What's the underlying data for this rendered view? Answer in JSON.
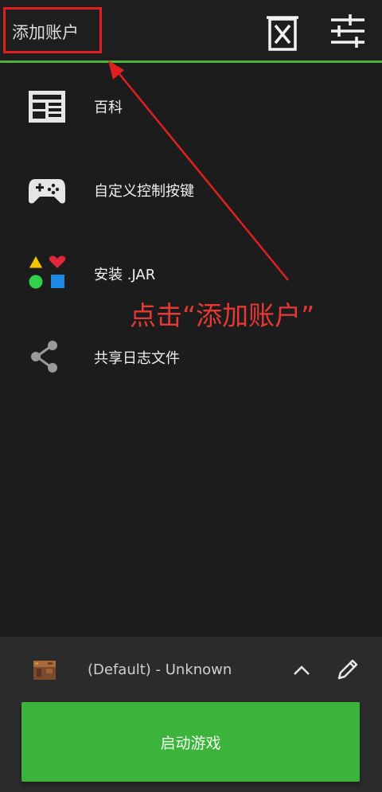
{
  "topbar": {
    "account_label": "添加账户",
    "delete_icon": "delete-version-icon",
    "settings_icon": "settings-sliders-icon"
  },
  "menu": {
    "items": [
      {
        "label": "百科",
        "icon": "wiki-icon"
      },
      {
        "label": "自定义控制按键",
        "icon": "gamepad-icon"
      },
      {
        "label": "安装 .JAR",
        "icon": "install-jar-icon"
      },
      {
        "label": "共享日志文件",
        "icon": "share-icon"
      }
    ]
  },
  "annotation": {
    "text": "点击“添加账户”",
    "color": "#e53935"
  },
  "bottom": {
    "version_label": "(Default) - Unknown",
    "play_label": "启动游戏"
  },
  "colors": {
    "accent": "#4fb33b",
    "play_button": "#3cb43c",
    "background": "#1c1c1c"
  }
}
